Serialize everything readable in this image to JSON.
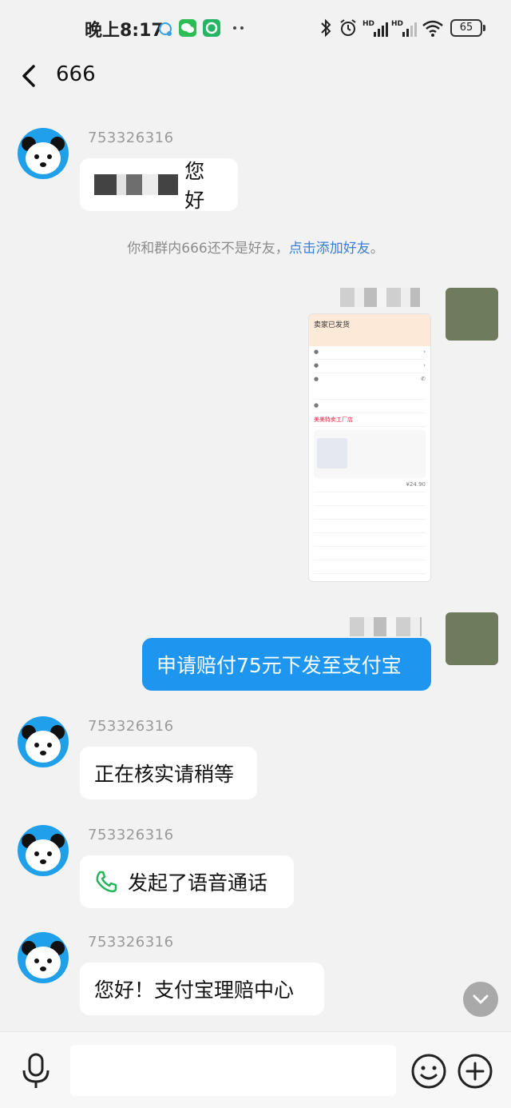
{
  "status_bar": {
    "time": "晚上8:17",
    "battery": "65"
  },
  "header": {
    "title": "666"
  },
  "messages": [
    {
      "sender": "753326316",
      "text": "您好"
    },
    {
      "notice_text": "你和群内666还不是好友，",
      "notice_link": "点击添加好友",
      "notice_end": "。"
    },
    {
      "mine_text": "申请赔付75元下发至支付宝"
    },
    {
      "sender": "753326316",
      "text": "正在核实请稍等"
    },
    {
      "sender": "753326316",
      "text": "发起了语音通话"
    },
    {
      "sender": "753326316",
      "text": "您好！支付宝理赔中心"
    }
  ],
  "screenshot": {
    "title": "卖家已发货",
    "shop": "美美特卖工厂店",
    "price": "¥24.90"
  },
  "input": {
    "placeholder": ""
  },
  "colors": {
    "mine_bubble": "#1e96f0",
    "link": "#3b7ed8",
    "avatar_bg": "#1fa0e8"
  }
}
